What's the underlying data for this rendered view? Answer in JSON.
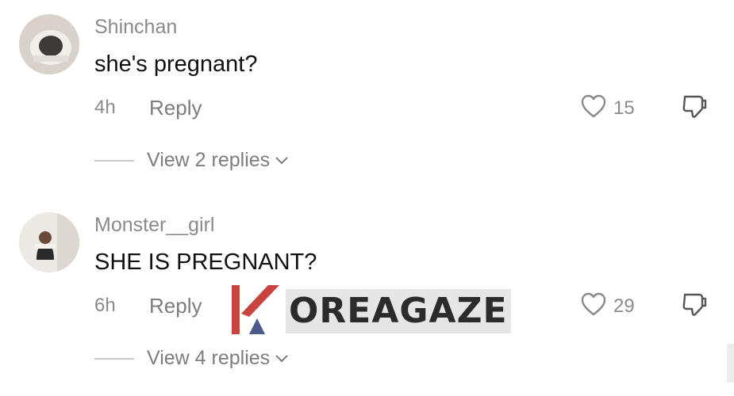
{
  "comments": [
    {
      "username": "Shinchan",
      "text": "she's pregnant?",
      "time": "4h",
      "reply_label": "Reply",
      "likes": "15",
      "view_replies": "View 2 replies",
      "avatar": "round-device-photo"
    },
    {
      "username": "Monster__girl",
      "text": "SHE IS PREGNANT?",
      "time": "6h",
      "reply_label": "Reply",
      "likes": "29",
      "view_replies": "View 4 replies",
      "avatar": "person-photo"
    }
  ],
  "watermark": {
    "text": "OREAGAZE",
    "logo_color": "#c9433f",
    "accent_color": "#4a5a8a"
  },
  "icons": [
    "heart-icon",
    "thumbs-down-icon",
    "chevron-down-icon"
  ]
}
